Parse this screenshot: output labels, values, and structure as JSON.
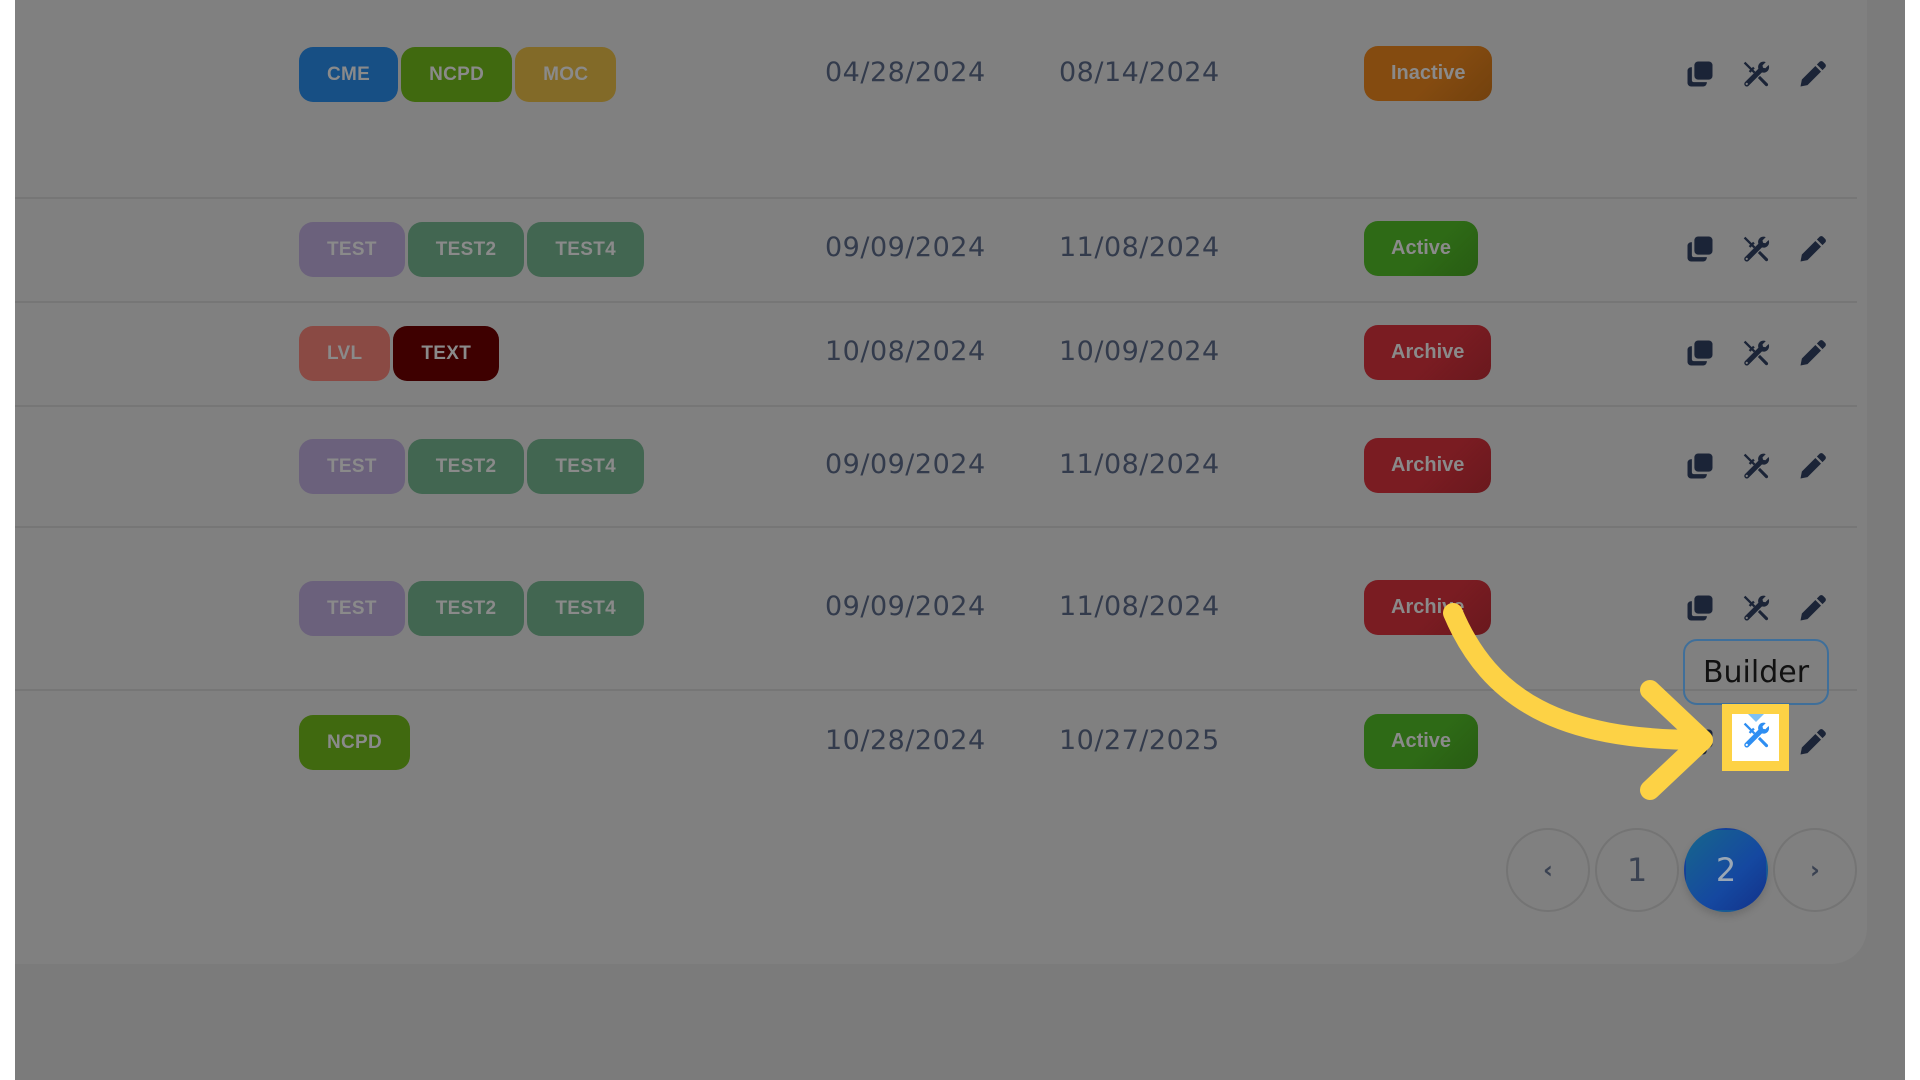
{
  "rows": [
    {
      "tags": [
        {
          "label": "CME",
          "color": "#174f84"
        },
        {
          "label": "NCPD",
          "color": "#40690f"
        },
        {
          "label": "MOC",
          "color": "#826a28"
        }
      ],
      "start_date": "04/28/2024",
      "end_date": "08/14/2024",
      "status": {
        "label": "Inactive",
        "color": "#844b10"
      }
    },
    {
      "tags": [
        {
          "label": "TEST",
          "color": "#6b617c"
        },
        {
          "label": "TEST2",
          "color": "#426651"
        },
        {
          "label": "TEST4",
          "color": "#426651"
        }
      ],
      "start_date": "09/09/2024",
      "end_date": "11/08/2024",
      "status": {
        "label": "Active",
        "color": "#2e6a16"
      }
    },
    {
      "tags": [
        {
          "label": "LVL",
          "color": "#8a4a44"
        },
        {
          "label": "TEXT",
          "color": "#3e0000"
        }
      ],
      "start_date": "10/08/2024",
      "end_date": "10/09/2024",
      "status": {
        "label": "Archive",
        "color": "#7a1c22"
      }
    },
    {
      "tags": [
        {
          "label": "TEST",
          "color": "#6b617c"
        },
        {
          "label": "TEST2",
          "color": "#426651"
        },
        {
          "label": "TEST4",
          "color": "#426651"
        }
      ],
      "start_date": "09/09/2024",
      "end_date": "11/08/2024",
      "status": {
        "label": "Archive",
        "color": "#7a1c22"
      }
    },
    {
      "tags": [
        {
          "label": "TEST",
          "color": "#6b617c"
        },
        {
          "label": "TEST2",
          "color": "#426651"
        },
        {
          "label": "TEST4",
          "color": "#426651"
        }
      ],
      "start_date": "09/09/2024",
      "end_date": "11/08/2024",
      "status": {
        "label": "Archive",
        "color": "#7a1c22"
      }
    },
    {
      "tags": [
        {
          "label": "NCPD",
          "color": "#40690f"
        }
      ],
      "start_date": "10/28/2024",
      "end_date": "10/27/2025",
      "status": {
        "label": "Active",
        "color": "#2e6a16"
      }
    }
  ],
  "actions": {
    "icons": [
      "copy-icon",
      "tools-icon",
      "edit-icon"
    ],
    "icon_color": "#1b2437"
  },
  "tooltip": {
    "label": "Builder"
  },
  "highlight": {
    "icon": "tools-icon",
    "icon_color": "#2e8ef2",
    "border_color": "#fdd245"
  },
  "pagination": {
    "prev": "‹",
    "pages": [
      "1",
      "2"
    ],
    "current": "2",
    "next": "›"
  }
}
